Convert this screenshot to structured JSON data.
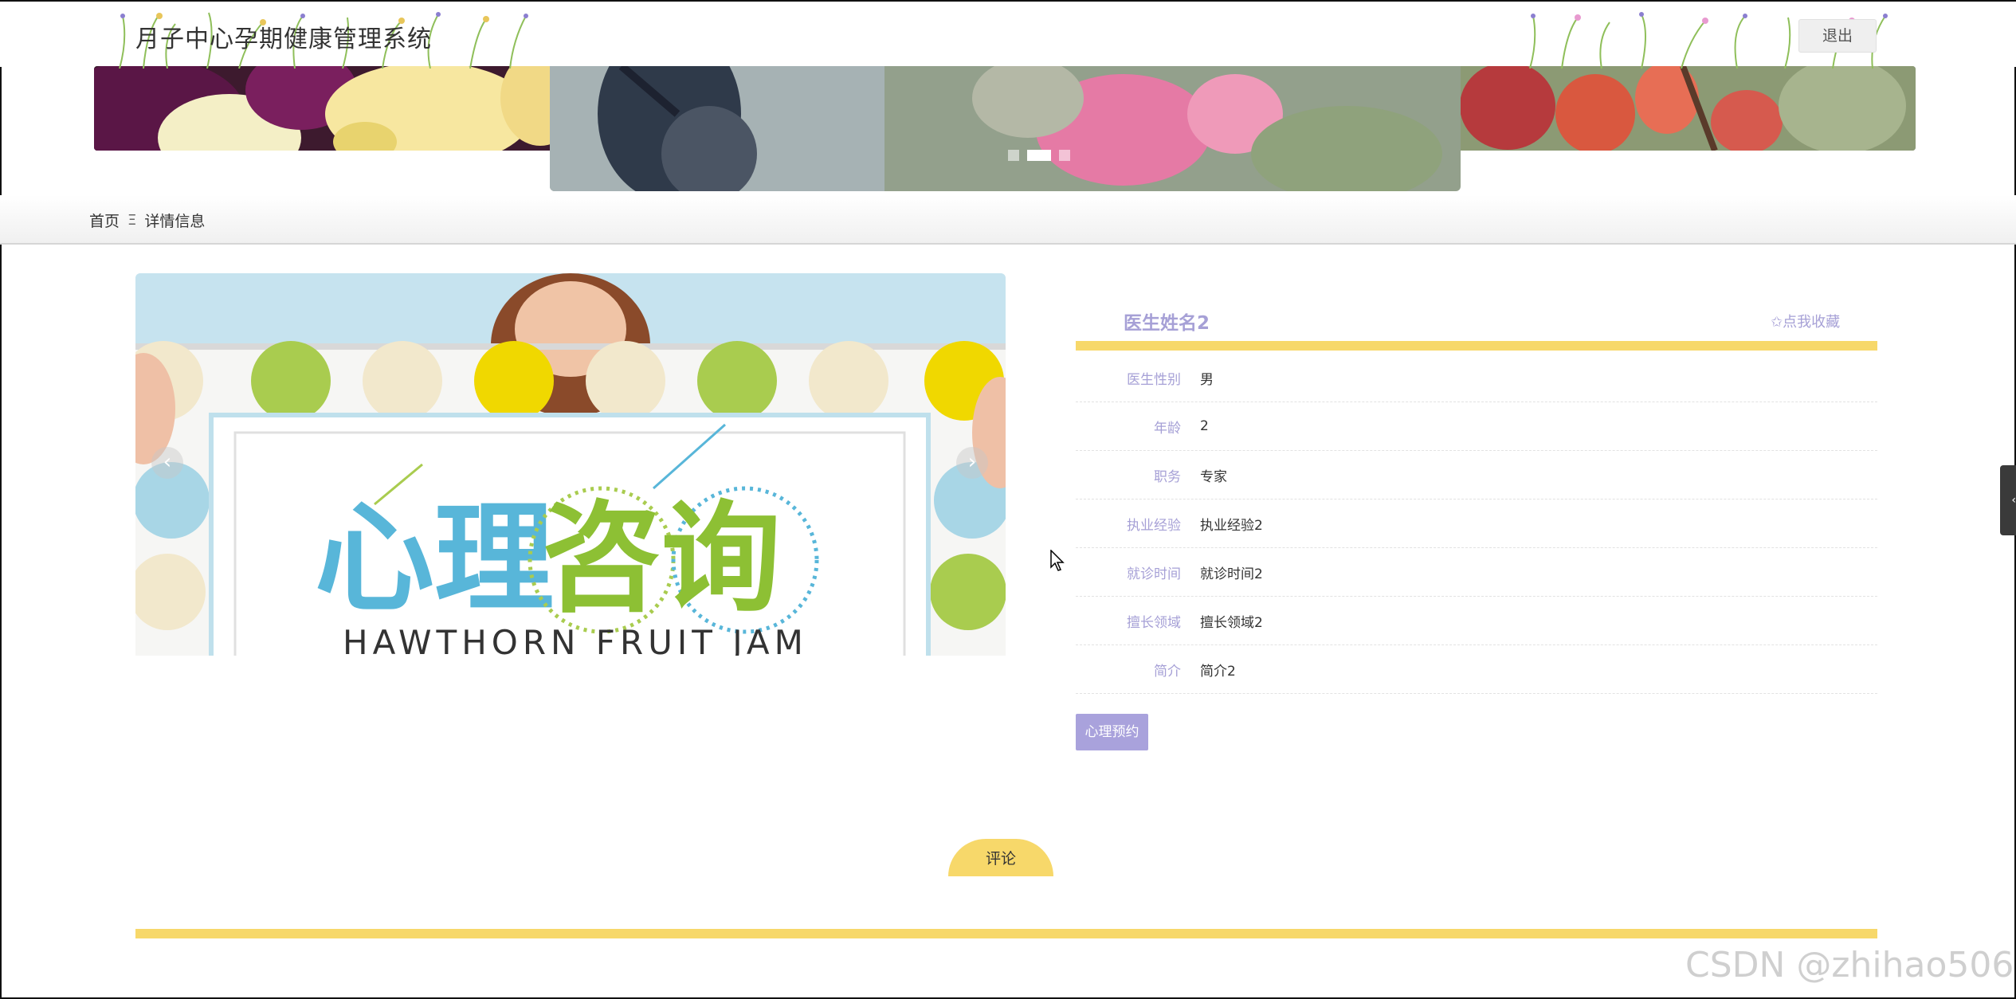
{
  "header": {
    "title": "月子中心孕期健康管理系统",
    "logout_label": "退出"
  },
  "banner": {
    "slide_count": 3,
    "active_index": 1
  },
  "breadcrumb": {
    "home": "首页",
    "separator": "Ξ",
    "current": "详情信息"
  },
  "gallery": {
    "image_text": "心理咨询",
    "image_subtext": "HAWTHORN FRUIT JAM",
    "prev_symbol": "‹",
    "next_symbol": "›"
  },
  "detail": {
    "name": "医生姓名2",
    "favorite_label": "✩点我收藏",
    "fields": [
      {
        "label": "医生性别",
        "value": "男"
      },
      {
        "label": "年龄",
        "value": "2"
      },
      {
        "label": "职务",
        "value": "专家"
      },
      {
        "label": "执业经验",
        "value": "执业经验2"
      },
      {
        "label": "就诊时间",
        "value": "就诊时间2"
      },
      {
        "label": "擅长领域",
        "value": "擅长领域2"
      },
      {
        "label": "简介",
        "value": "简介2"
      }
    ],
    "appoint_label": "心理预约"
  },
  "comments": {
    "tab_label": "评论"
  },
  "side_handle_symbol": "‹",
  "watermark": "CSDN @zhihao506",
  "colors": {
    "accent_purple": "#a6a0d6",
    "accent_yellow": "#f7d86a",
    "button_purple": "#a9a2dc"
  }
}
